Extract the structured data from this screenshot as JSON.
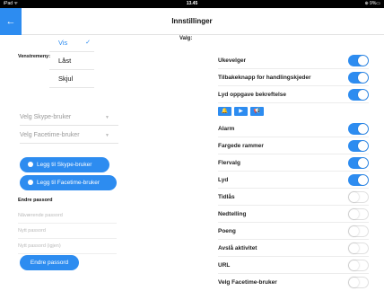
{
  "statusbar": {
    "carrier": "iPad ᯤ",
    "time": "13.45",
    "battery": "⊕ 9%▭"
  },
  "header": {
    "back_icon": "back-arrow-icon",
    "title": "Innstillinger"
  },
  "valg_label": "Valg:",
  "sidebar_menu": {
    "label": "Venstremeny:",
    "options": [
      {
        "label": "Vis",
        "selected": true
      },
      {
        "label": "Låst",
        "selected": false
      },
      {
        "label": "Skjul",
        "selected": false
      }
    ],
    "check_glyph": "✓"
  },
  "selects": {
    "skype": "Velg Skype-bruker",
    "facetime": "Velg Facetime-bruker",
    "caret": "▼"
  },
  "buttons": {
    "add_skype": "Legg til Skype-bruker",
    "add_facetime": "Legg til Facetime-bruker",
    "change_password": "Endre passord"
  },
  "password": {
    "label": "Endre passord",
    "current_placeholder": "Nåværende passord",
    "new_placeholder": "Nytt passord",
    "repeat_placeholder": "Nytt passord (igjen)"
  },
  "settings": {
    "ukevelger": {
      "label": "Ukevelger",
      "on": true
    },
    "tilbake": {
      "label": "Tilbakeknapp for handlingskjeder",
      "on": true
    },
    "lyd_oppgave": {
      "label": "Lyd oppgave bekreftelse",
      "on": true
    },
    "alarm": {
      "label": "Alarm",
      "on": true
    },
    "fargede": {
      "label": "Fargede rammer",
      "on": true
    },
    "flervalg": {
      "label": "Flervalg",
      "on": true
    },
    "lyd": {
      "label": "Lyd",
      "on": true
    },
    "tidlas": {
      "label": "Tidlås",
      "on": false
    },
    "nedtelling": {
      "label": "Nedtelling",
      "on": false
    },
    "poeng": {
      "label": "Poeng",
      "on": false
    },
    "avsla": {
      "label": "Avslå aktivitet",
      "on": false
    },
    "url": {
      "label": "URL",
      "on": false
    },
    "facetime": {
      "label": "Velg Facetime-bruker",
      "on": false
    }
  },
  "sound_icons": [
    {
      "name": "bell-icon",
      "glyph": "🔔"
    },
    {
      "name": "play-icon",
      "glyph": "▶"
    },
    {
      "name": "megaphone-icon",
      "glyph": "📢"
    }
  ],
  "colors": {
    "accent": "#2d8cf0",
    "statusbar": "#000000"
  }
}
